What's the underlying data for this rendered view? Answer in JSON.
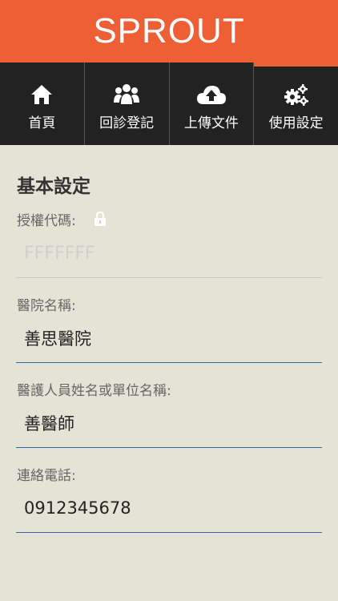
{
  "app": {
    "title": "SPROUT"
  },
  "nav": {
    "tabs": [
      {
        "label": "首頁",
        "icon": "home-icon"
      },
      {
        "label": "回診登記",
        "icon": "users-icon"
      },
      {
        "label": "上傳文件",
        "icon": "cloud-upload-icon"
      },
      {
        "label": "使用設定",
        "icon": "gears-icon",
        "active": true
      }
    ]
  },
  "settings": {
    "title": "基本設定",
    "auth_code": {
      "label": "授權代碼:",
      "value": "FFFFFFF",
      "icon": "lock-icon"
    },
    "hospital_name": {
      "label": "醫院名稱:",
      "value": "善思醫院"
    },
    "staff_name": {
      "label": "醫護人員姓名或單位名稱:",
      "value": "善醫師"
    },
    "phone": {
      "label": "連絡電話:",
      "value": "0912345678"
    }
  },
  "colors": {
    "header": "#ef5f35",
    "nav": "#222222",
    "background": "#e4e3d6",
    "underline": "#2f6aa8"
  }
}
